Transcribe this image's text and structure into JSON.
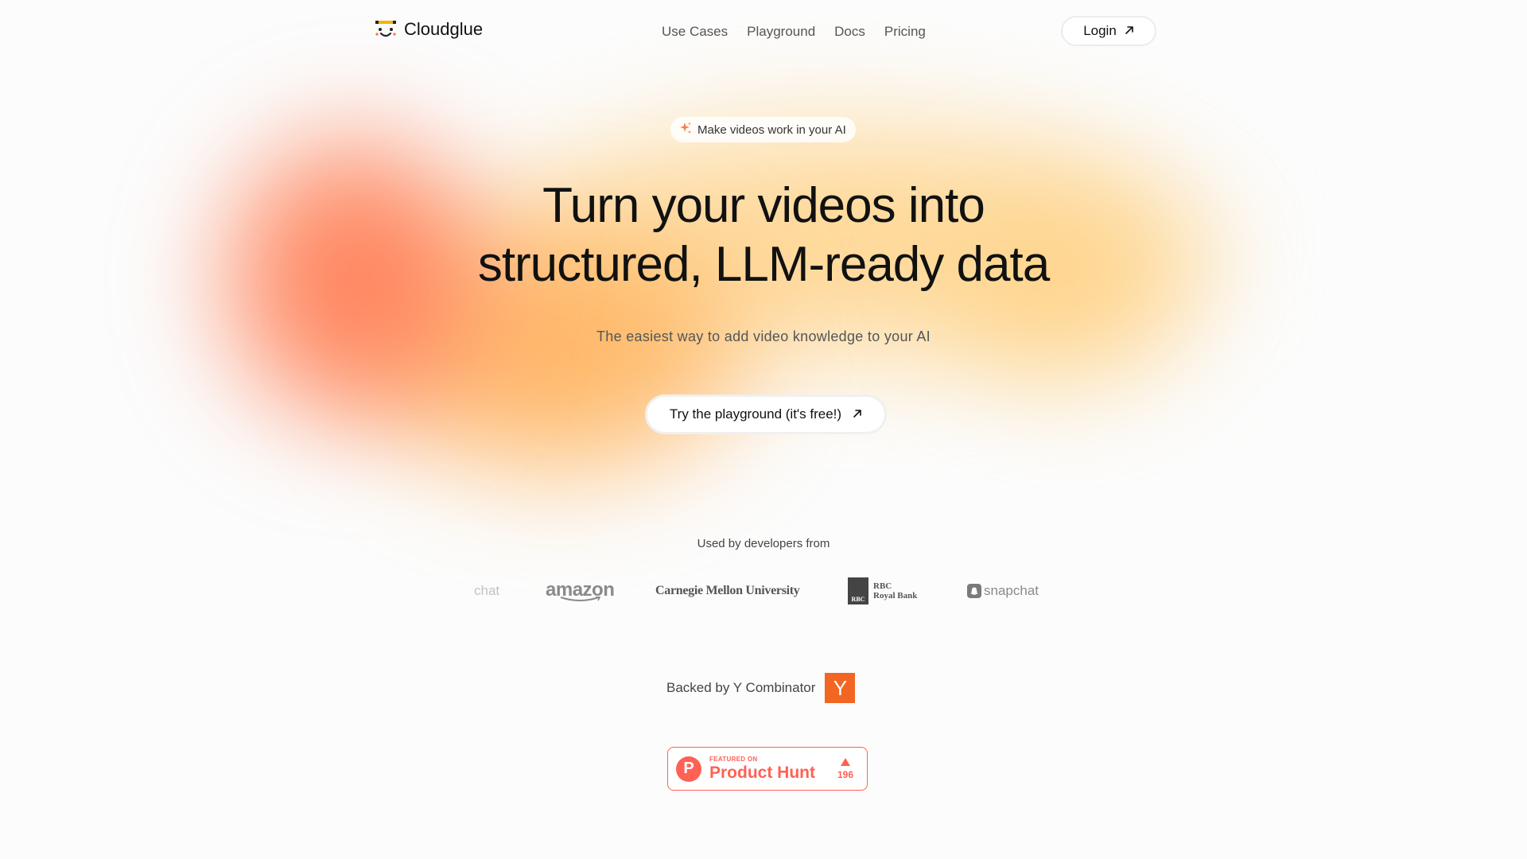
{
  "brand": {
    "name": "Cloudglue",
    "accent": "#ff7a45"
  },
  "nav": {
    "items": [
      {
        "label": "Use Cases"
      },
      {
        "label": "Playground"
      },
      {
        "label": "Docs"
      },
      {
        "label": "Pricing"
      }
    ],
    "login_label": "Login"
  },
  "hero": {
    "pill_label": "Make videos work in your AI",
    "headline_line1": "Turn your videos into",
    "headline_line2": "structured, LLM-ready data",
    "subtitle": "The easiest way to add video knowledge to your AI",
    "cta_label": "Try the playground (it's free!)"
  },
  "trusted": {
    "label": "Used by developers from",
    "logos": [
      {
        "name": "Snapchat (partial)",
        "text": "chat"
      },
      {
        "name": "Amazon",
        "text": "amazon"
      },
      {
        "name": "Carnegie Mellon University",
        "text": "Carnegie Mellon University"
      },
      {
        "name": "RBC Royal Bank",
        "text_mark": "RBC",
        "text_line1": "RBC",
        "text_line2": "Royal Bank"
      },
      {
        "name": "Snapchat",
        "text": "snapchat"
      }
    ]
  },
  "backing": {
    "label": "Backed by Y Combinator",
    "yc_letter": "Y",
    "yc_color": "#f26522"
  },
  "product_hunt": {
    "featured_on": "FEATURED ON",
    "name": "Product Hunt",
    "letter": "P",
    "votes": "196",
    "color": "#ff6154"
  }
}
